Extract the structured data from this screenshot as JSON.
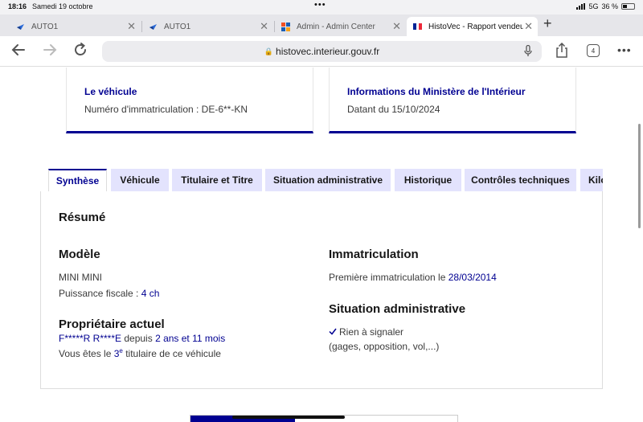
{
  "status_bar": {
    "time": "18:16",
    "date": "Samedi 19 octobre",
    "network": "5G",
    "battery": "36 %"
  },
  "browser": {
    "tabs": [
      {
        "title": "AUTO1",
        "favicon": "auto1-logo-icon"
      },
      {
        "title": "AUTO1",
        "favicon": "auto1-logo-icon"
      },
      {
        "title": "Admin - Admin Center",
        "favicon": "admin-center-icon"
      },
      {
        "title": "HistoVec - Rapport vendeur",
        "favicon": "french-flag-icon"
      }
    ],
    "active_tab": 3,
    "url": "histovec.interieur.gouv.fr",
    "tab_count": "4"
  },
  "cards": {
    "vehicle": {
      "heading": "Le véhicule",
      "text": "Numéro d'immatriculation : DE-6**-KN"
    },
    "ministry": {
      "heading": "Informations du Ministère de l'Intérieur",
      "text": "Datant du 15/10/2024"
    }
  },
  "page_tabs": [
    "Synthèse",
    "Véhicule",
    "Titulaire et Titre",
    "Situation administrative",
    "Historique",
    "Contrôles techniques",
    "Kilométrage"
  ],
  "summary": {
    "title": "Résumé",
    "model": {
      "heading": "Modèle",
      "name": "MINI MINI",
      "fiscal_label": "Puissance fiscale : ",
      "fiscal_value": "4 ch"
    },
    "owner": {
      "heading": "Propriétaire actuel",
      "name": "F*****R R****E",
      "since_label": " depuis ",
      "since_value": "2 ans et 11 mois",
      "rank_prefix": "Vous êtes le ",
      "rank_num": "3",
      "rank_sup": "e",
      "rank_suffix": " titulaire de ce véhicule"
    },
    "registration": {
      "heading": "Immatriculation",
      "label": "Première immatriculation le ",
      "date": "28/03/2014"
    },
    "admin_status": {
      "heading": "Situation administrative",
      "status": "Rien à signaler",
      "detail": "(gages, opposition, vol,...)"
    }
  }
}
